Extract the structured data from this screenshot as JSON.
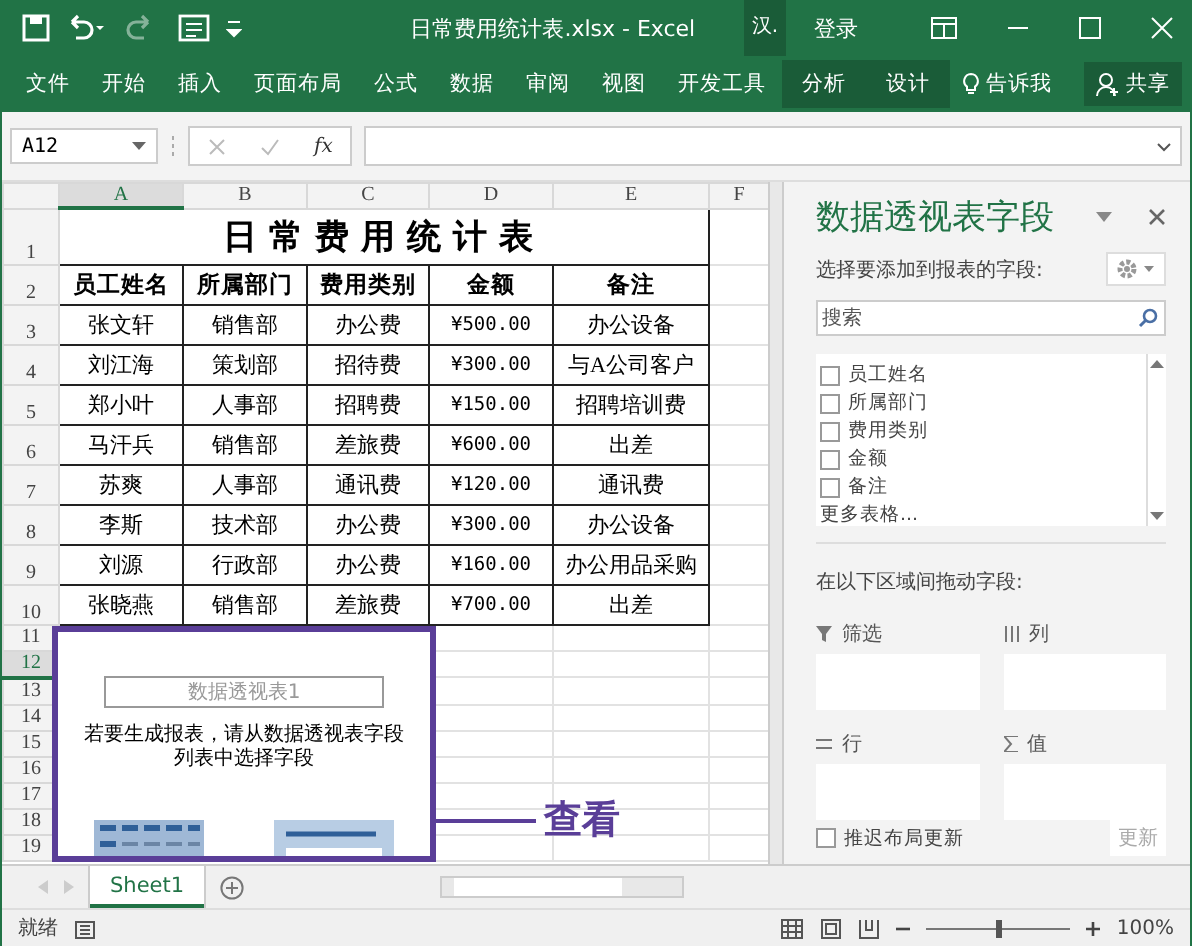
{
  "window": {
    "title": "日常费用统计表.xlsx  -  Excel",
    "context_tab": "汉.",
    "sign_in": "登录"
  },
  "ribbon": {
    "tabs": [
      {
        "label": "文件",
        "selected": false,
        "kind": "normal"
      },
      {
        "label": "开始",
        "selected": false,
        "kind": "normal"
      },
      {
        "label": "插入",
        "selected": false,
        "kind": "normal"
      },
      {
        "label": "页面布局",
        "selected": false,
        "kind": "normal"
      },
      {
        "label": "公式",
        "selected": false,
        "kind": "normal"
      },
      {
        "label": "数据",
        "selected": false,
        "kind": "normal"
      },
      {
        "label": "审阅",
        "selected": false,
        "kind": "normal"
      },
      {
        "label": "视图",
        "selected": false,
        "kind": "normal"
      },
      {
        "label": "开发工具",
        "selected": false,
        "kind": "normal"
      },
      {
        "label": "分析",
        "selected": false,
        "kind": "context"
      },
      {
        "label": "设计",
        "selected": false,
        "kind": "context"
      }
    ],
    "tell_me": "告诉我",
    "share": "共享"
  },
  "formula_bar": {
    "name_box": "A12",
    "fx": "fx"
  },
  "sheet": {
    "columns": [
      {
        "label": "A",
        "selected": true
      },
      {
        "label": "B",
        "selected": false
      },
      {
        "label": "C",
        "selected": false
      },
      {
        "label": "D",
        "selected": false
      },
      {
        "label": "E",
        "selected": false
      },
      {
        "label": "F",
        "selected": false
      }
    ],
    "title": "日常费用统计表",
    "headers": [
      "员工姓名",
      "所属部门",
      "费用类别",
      "金额",
      "备注"
    ],
    "rows": [
      [
        "张文轩",
        "销售部",
        "办公费",
        "¥500.00",
        "办公设备"
      ],
      [
        "刘江海",
        "策划部",
        "招待费",
        "¥300.00",
        "与A公司客户"
      ],
      [
        "郑小叶",
        "人事部",
        "招聘费",
        "¥150.00",
        "招聘培训费"
      ],
      [
        "马汗兵",
        "销售部",
        "差旅费",
        "¥600.00",
        "出差"
      ],
      [
        "苏爽",
        "人事部",
        "通讯费",
        "¥120.00",
        "通讯费"
      ],
      [
        "李斯",
        "技术部",
        "办公费",
        "¥300.00",
        "办公设备"
      ],
      [
        "刘源",
        "行政部",
        "办公费",
        "¥160.00",
        "办公用品采购"
      ],
      [
        "张晓燕",
        "销售部",
        "差旅费",
        "¥700.00",
        "出差"
      ]
    ],
    "row_numbers": [
      {
        "label": "1",
        "selected": false
      },
      {
        "label": "2",
        "selected": false
      },
      {
        "label": "3",
        "selected": false
      },
      {
        "label": "4",
        "selected": false
      },
      {
        "label": "5",
        "selected": false
      },
      {
        "label": "6",
        "selected": false
      },
      {
        "label": "7",
        "selected": false
      },
      {
        "label": "8",
        "selected": false
      },
      {
        "label": "9",
        "selected": false
      },
      {
        "label": "10",
        "selected": false
      },
      {
        "label": "11",
        "selected": false
      },
      {
        "label": "12",
        "selected": true
      },
      {
        "label": "13",
        "selected": false
      },
      {
        "label": "14",
        "selected": false
      },
      {
        "label": "15",
        "selected": false
      },
      {
        "label": "16",
        "selected": false
      },
      {
        "label": "17",
        "selected": false
      },
      {
        "label": "18",
        "selected": false
      },
      {
        "label": "19",
        "selected": false
      }
    ]
  },
  "pivot_placeholder": {
    "name": "数据透视表1",
    "message": "若要生成报表，请从数据透视表字段列表中选择字段"
  },
  "callout": {
    "label": "查看"
  },
  "field_pane": {
    "title": "数据透视表字段",
    "subtitle": "选择要添加到报表的字段:",
    "search": {
      "placeholder": "搜索"
    },
    "fields": [
      {
        "label": "员工姓名",
        "checked": false
      },
      {
        "label": "所属部门",
        "checked": false
      },
      {
        "label": "费用类别",
        "checked": false
      },
      {
        "label": "金额",
        "checked": false
      },
      {
        "label": "备注",
        "checked": false
      }
    ],
    "more_tables": "更多表格...",
    "drag_hint": "在以下区域间拖动字段:",
    "areas": [
      {
        "kind": "filter",
        "label": "筛选"
      },
      {
        "kind": "columns",
        "label": "列"
      },
      {
        "kind": "rows",
        "label": "行"
      },
      {
        "kind": "values",
        "label": "值"
      }
    ],
    "defer_update": {
      "label": "推迟布局更新",
      "checked": false
    },
    "update_button": {
      "label": "更新",
      "disabled": true
    }
  },
  "sheet_tabs": [
    {
      "label": "Sheet1",
      "selected": true
    }
  ],
  "status_bar": {
    "status": "就绪",
    "zoom": {
      "level": 0.5
    },
    "zoom_label": "100%"
  }
}
